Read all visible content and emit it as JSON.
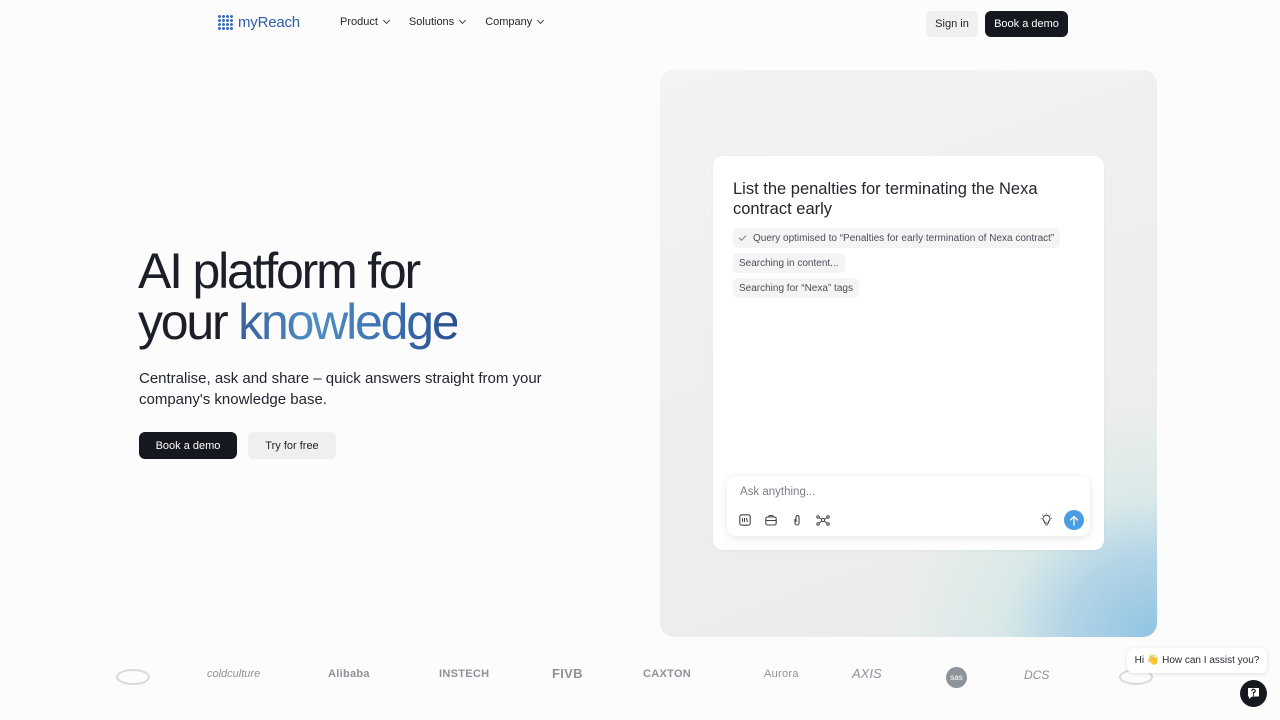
{
  "brand": {
    "name": "myReach"
  },
  "nav": {
    "items": [
      {
        "label": "Product"
      },
      {
        "label": "Solutions"
      },
      {
        "label": "Company"
      }
    ],
    "sign_in": "Sign in",
    "book_demo": "Book a demo"
  },
  "hero": {
    "title_line1": "AI platform for",
    "title_line2_a": "your ",
    "title_line2_b": "knowledge",
    "subtitle": "Centralise, ask and share – quick answers straight from your company's knowledge base.",
    "primary_cta": "Book a demo",
    "secondary_cta": "Try for free"
  },
  "demo": {
    "question": "List the penalties for terminating the Nexa contract early",
    "steps": [
      "Query optimised to “Penalties for early termination of Nexa contract”",
      "Searching in content...",
      "Searching for “Nexa” tags"
    ],
    "input_placeholder": "Ask anything...",
    "accent": "#4a9ce3"
  },
  "logos": [
    "coldculture",
    "Alibaba",
    "INSTECH",
    "FIVB",
    "CAXTON",
    "Aurora",
    "AXIS",
    "sas",
    "DCS"
  ],
  "chat": {
    "greeting": "Hi 👋 How can I assist you?"
  }
}
